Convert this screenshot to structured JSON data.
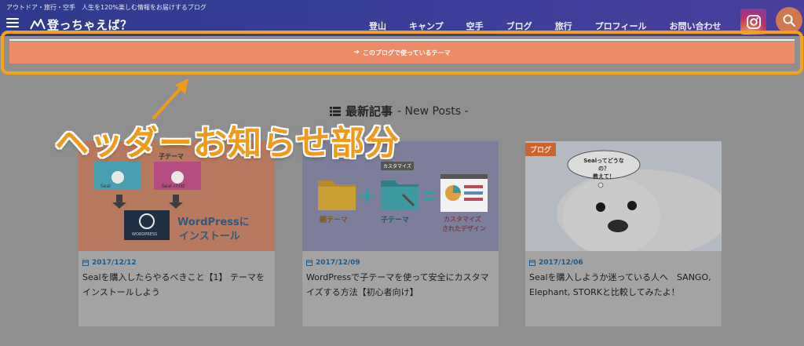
{
  "header": {
    "tagline": "アウトドア・旅行・空手　人生を120%楽しむ情報をお届けするブログ",
    "logo_text": "登っちゃえば？",
    "nav": [
      "登山",
      "キャンプ",
      "空手",
      "ブログ",
      "旅行",
      "プロフィール",
      "お問い合わせ"
    ]
  },
  "notice": {
    "text": "このブログで使っているテーマ"
  },
  "section": {
    "title_ja": "最新記事",
    "title_en": "- New Posts -"
  },
  "annotation": {
    "text": "ヘッダーお知らせ部分"
  },
  "cards": [
    {
      "date": "2017/12/12",
      "title": "Sealを購入したらやるべきこと【1】 テーマをインストールしよう",
      "thumb": {
        "parent_label": "親テーマ",
        "child_label": "子テーマ",
        "small_label_a": "Seal",
        "small_label_b": "Seal child",
        "wp_label": "WORDPRESS",
        "headline_1": "WordPressに",
        "headline_2": "インストール"
      }
    },
    {
      "date": "2017/12/09",
      "title": "WordPressで子テーマを使って安全にカスタマイズする方法【初心者向け】",
      "thumb": {
        "parent": "親テーマ",
        "child": "子テーマ",
        "customize_tag": "カスタマイズ",
        "result_1": "カスタマイズ",
        "result_2": "されたデザイン"
      }
    },
    {
      "date": "2017/12/06",
      "title": "Sealを購入しようか迷っている人へ　SANGO, Elephant, STORKと比較してみたよ！",
      "category": "ブログ",
      "bubble": "Sealってどうなの？\n教えて！"
    }
  ],
  "colors": {
    "header": "#3c3f9a",
    "notice": "#ec8b65",
    "highlight": "#f3a31a",
    "annotation": "#f09a1c",
    "date": "#1f5a8c"
  }
}
